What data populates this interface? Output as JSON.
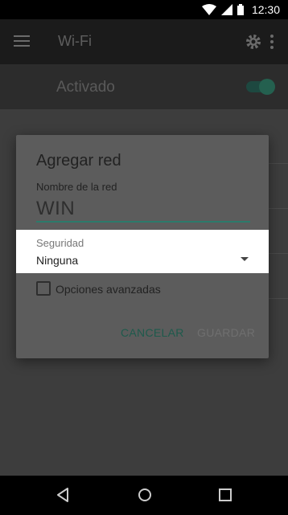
{
  "status_bar": {
    "time": "12:30",
    "icons": [
      "wifi-icon",
      "signal-icon",
      "battery-icon"
    ]
  },
  "app_bar": {
    "title": "Wi-Fi",
    "icons": [
      "menu-icon",
      "gear-icon",
      "overflow-menu-icon"
    ]
  },
  "wifi_switch": {
    "label": "Activado",
    "on": true
  },
  "dialog": {
    "title": "Agregar red",
    "ssid_label": "Nombre de la red",
    "ssid_value": "WIN",
    "security_label": "Seguridad",
    "security_value": "Ninguna",
    "advanced_label": "Opciones avanzadas",
    "advanced_checked": false,
    "cancel_label": "CANCELAR",
    "save_label": "GUARDAR"
  },
  "nav_bar": {
    "icons": [
      "back-icon",
      "home-icon",
      "recent-apps-icon"
    ]
  },
  "colors": {
    "accent": "#2c7a6b",
    "dialog_bg": "#5c5c5c",
    "dropdown_bg": "#ffffff"
  }
}
